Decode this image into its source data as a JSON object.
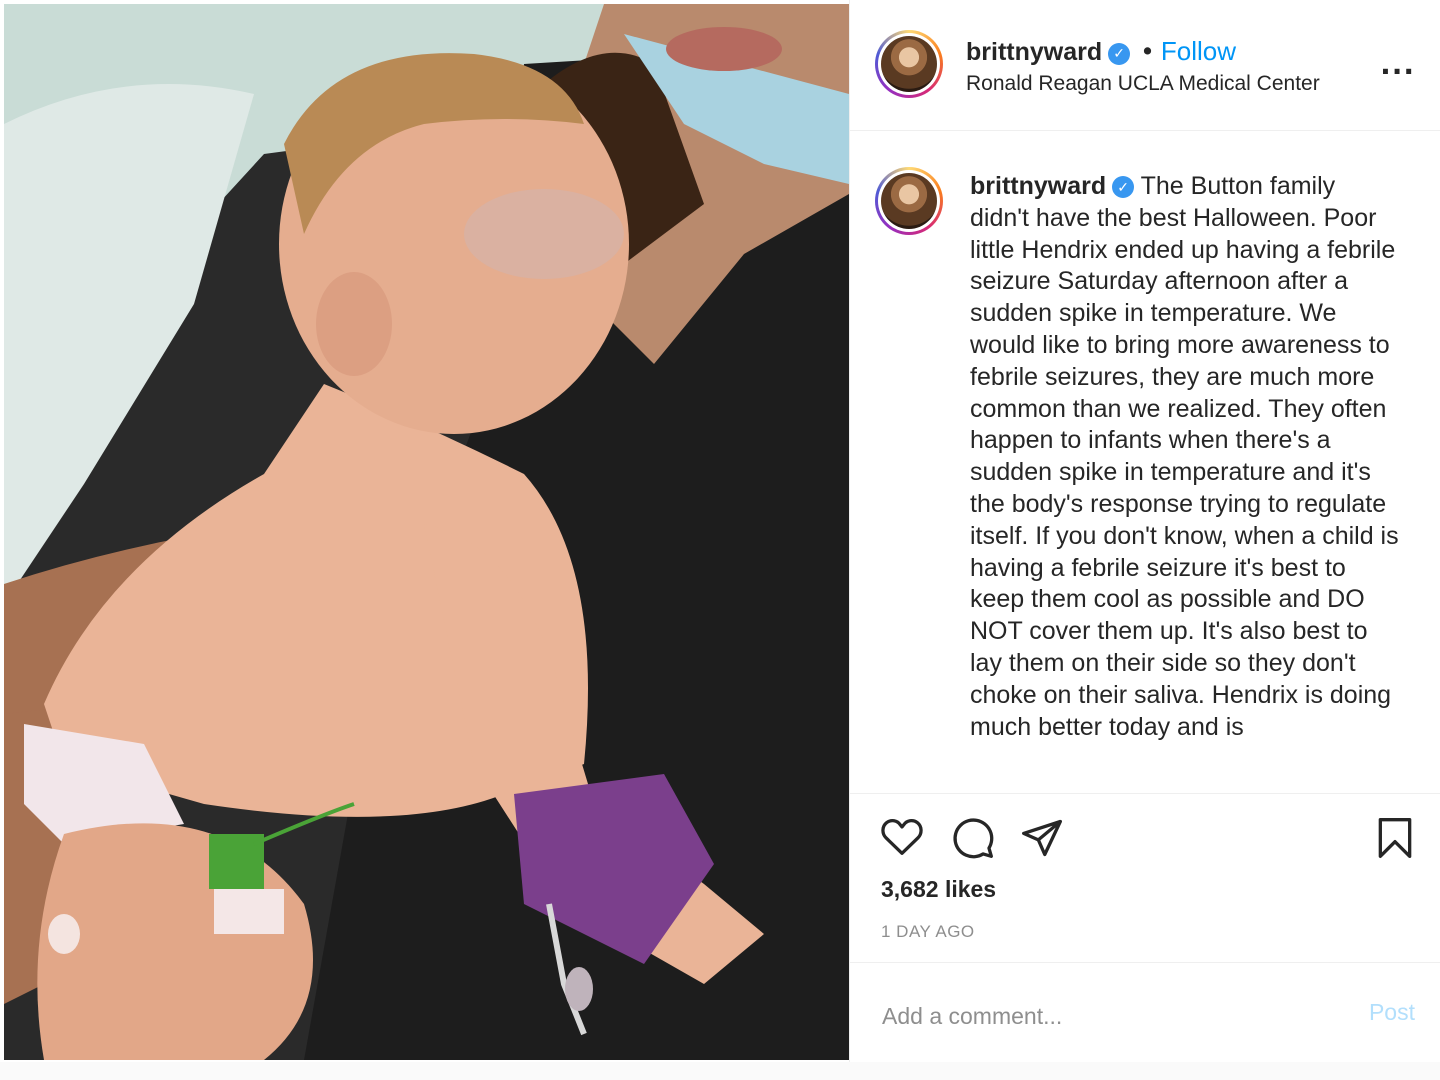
{
  "header": {
    "username": "brittnyward",
    "verified_glyph": "✓",
    "separator": "•",
    "follow_label": "Follow",
    "location": "Ronald Reagan UCLA Medical Center",
    "more_label": "..."
  },
  "caption": {
    "username": "brittnyward",
    "text": "The Button family didn't have the best Halloween. Poor little Hendrix ended up having a febrile seizure Saturday afternoon after a sudden spike in temperature. We would like to bring more awareness to febrile seizures, they are much more common than we realized. They often happen to infants when there's a sudden spike in temperature and it's the body's response trying to regulate itself. If you don't know, when a child is having a febrile seizure it's best to keep them cool as possible and DO NOT cover them up. It's also best to lay them on their side so they don't choke on their saliva. Hendrix is doing much better today and is"
  },
  "actions": {
    "like_icon": "heart-icon",
    "comment_icon": "comment-icon",
    "share_icon": "share-icon",
    "save_icon": "bookmark-icon"
  },
  "likes": "3,682 likes",
  "time_ago": "1 DAY AGO",
  "comment": {
    "placeholder": "Add a comment...",
    "post_label": "Post"
  },
  "colors": {
    "link_blue": "#0095f6",
    "post_disabled": "#b2dffc",
    "verified_blue": "#3897f0"
  }
}
